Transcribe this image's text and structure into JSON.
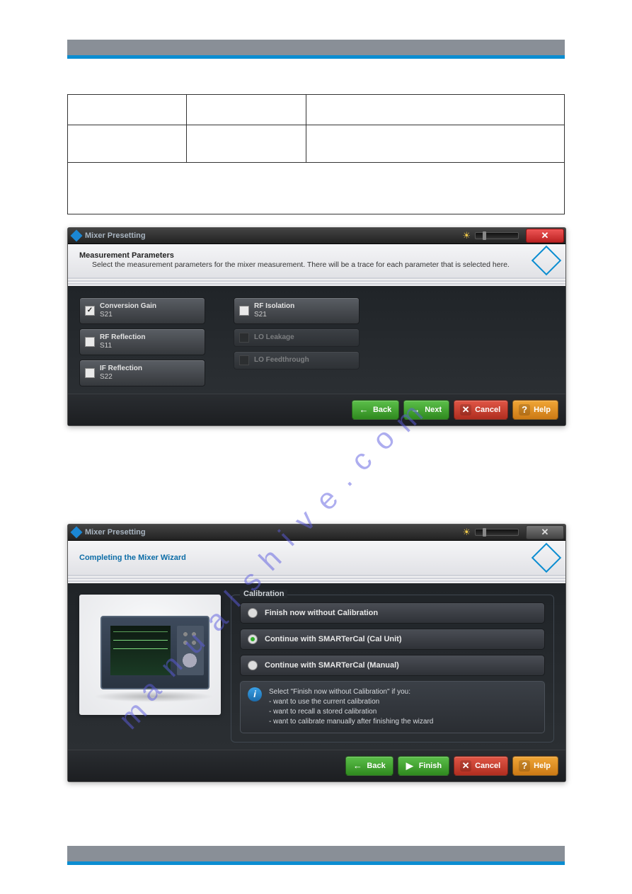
{
  "dialog1": {
    "title": "Mixer Presetting",
    "heading": "Measurement Parameters",
    "subtext": "Select the measurement parameters for the mixer measurement. There will be a trace for each parameter that is selected here.",
    "col1": [
      {
        "label": "Conversion Gain",
        "sub": "S21",
        "checked": true,
        "enabled": true
      },
      {
        "label": "RF Reflection",
        "sub": "S11",
        "checked": false,
        "enabled": true
      },
      {
        "label": "IF Reflection",
        "sub": "S22",
        "checked": false,
        "enabled": true
      }
    ],
    "col2": [
      {
        "label": "RF Isolation",
        "sub": "S21",
        "checked": false,
        "enabled": true
      },
      {
        "label": "LO Leakage",
        "sub": "",
        "checked": false,
        "enabled": false
      },
      {
        "label": "LO Feedthrough",
        "sub": "",
        "checked": false,
        "enabled": false
      }
    ],
    "buttons": {
      "back": "Back",
      "next": "Next",
      "cancel": "Cancel",
      "help": "Help"
    }
  },
  "dialog2": {
    "title": "Mixer Presetting",
    "heading": "Completing the Mixer Wizard",
    "group": "Calibration",
    "options": [
      {
        "label": "Finish now without Calibration",
        "selected": false
      },
      {
        "label": "Continue with SMARTerCal (Cal Unit)",
        "selected": true
      },
      {
        "label": "Continue with SMARTerCal (Manual)",
        "selected": false
      }
    ],
    "info_lead": "Select \"Finish now without Calibration\" if you:",
    "info_items": [
      "want to use the current calibration",
      "want to recall a stored calibration",
      "want to calibrate manually after finishing the wizard"
    ],
    "buttons": {
      "back": "Back",
      "finish": "Finish",
      "cancel": "Cancel",
      "help": "Help"
    }
  },
  "watermark": "manualshive.com"
}
